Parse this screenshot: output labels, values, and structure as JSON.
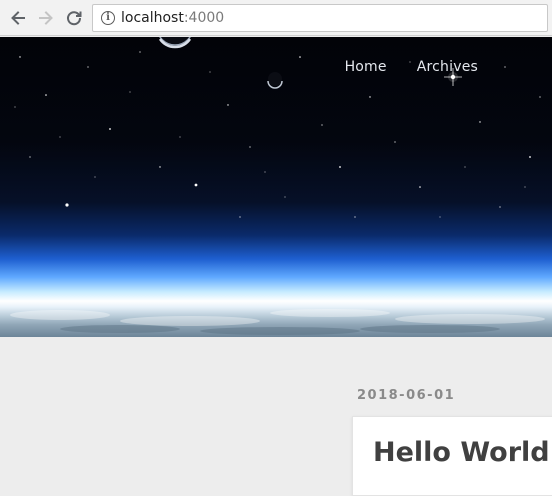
{
  "browser": {
    "url_host": "localhost",
    "url_port": ":4000"
  },
  "site_nav": {
    "items": [
      {
        "label": "Home"
      },
      {
        "label": "Archives"
      }
    ]
  },
  "post": {
    "date": "2018-06-01",
    "title": "Hello World"
  },
  "icons": {
    "back": "arrow-left-icon",
    "forward": "arrow-right-icon",
    "reload": "reload-icon",
    "info": "info-icon"
  },
  "colors": {
    "page_bg": "#ededed",
    "nav_text": "#e4e8ee",
    "date_text": "#8a8a8a",
    "title_text": "#404040"
  }
}
